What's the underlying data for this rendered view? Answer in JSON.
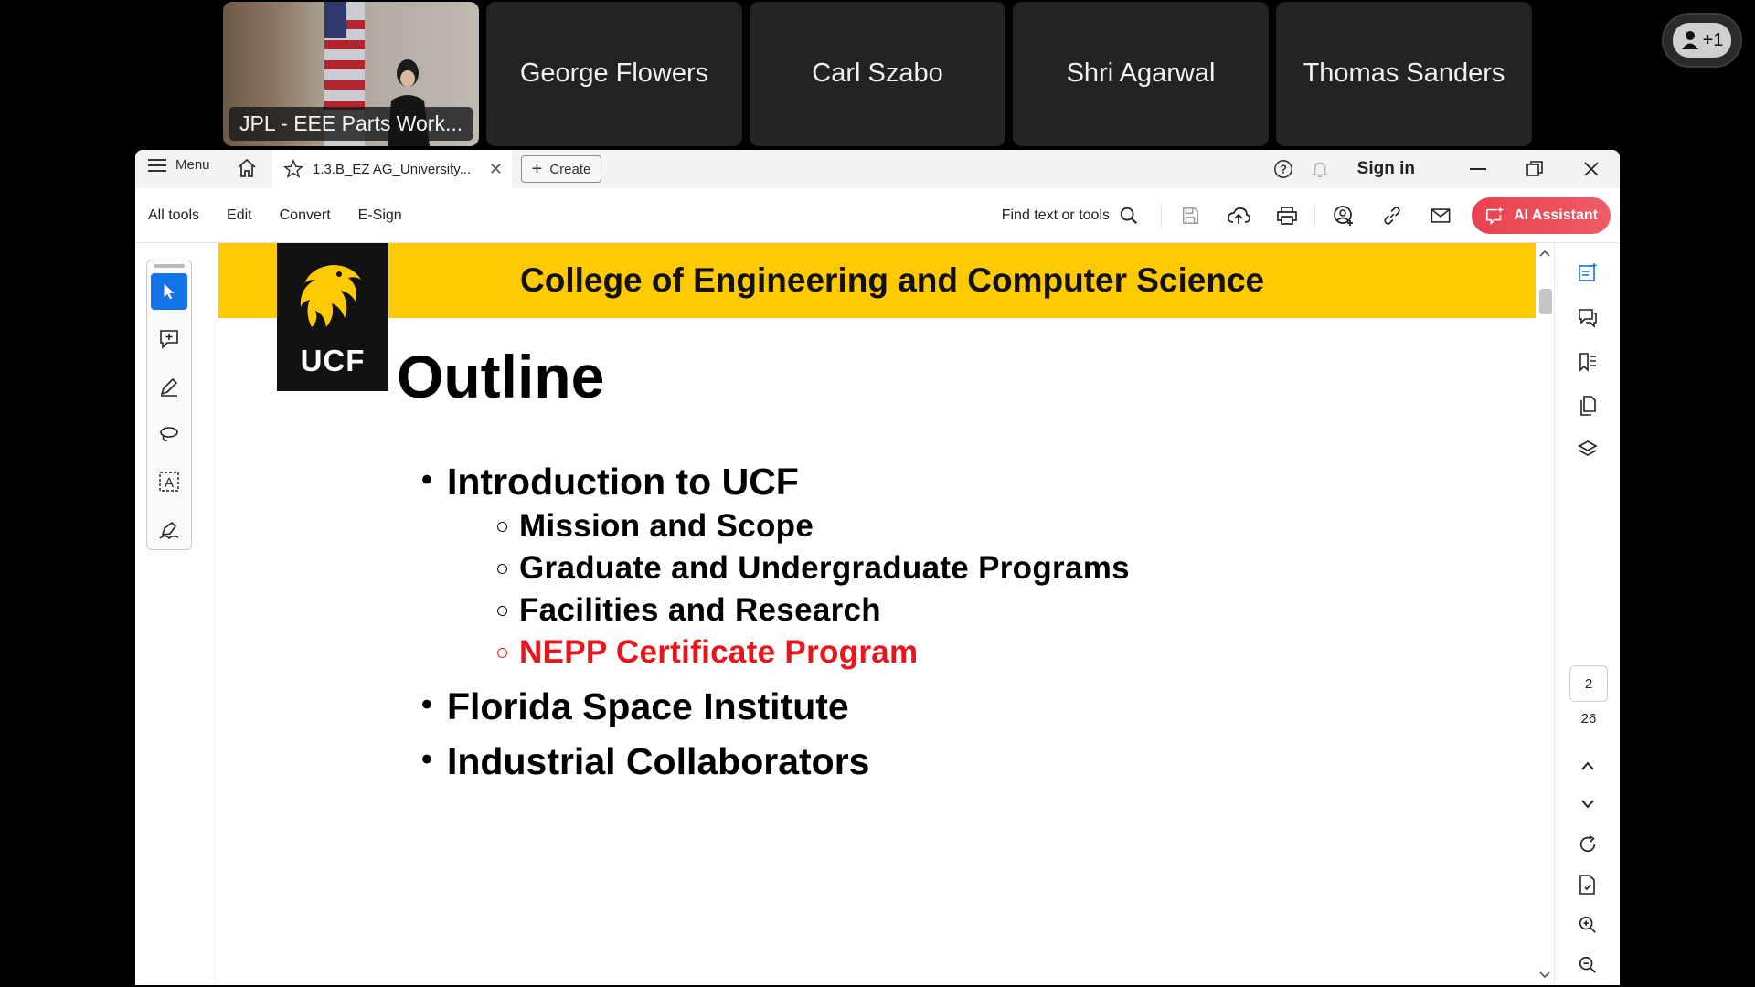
{
  "participants": {
    "video_label": "JPL - EEE Parts Work...",
    "names": [
      "George Flowers",
      "Carl Szabo",
      "Shri Agarwal",
      "Thomas Sanders"
    ],
    "more_count": "+1"
  },
  "titlebar": {
    "menu_label": "Menu",
    "tab_title": "1.3.B_EZ AG_University...",
    "create_label": "Create",
    "sign_in_label": "Sign in"
  },
  "toolbar": {
    "links": [
      "All tools",
      "Edit",
      "Convert",
      "E-Sign"
    ],
    "find_label": "Find text or tools",
    "ai_label": "AI Assistant"
  },
  "slide": {
    "header": "College of Engineering and Computer Science",
    "logo_text": "UCF",
    "title": "Outline",
    "bullets": [
      {
        "text": "Introduction to UCF",
        "sub": [
          "Mission and Scope",
          "Graduate and Undergraduate Programs",
          "Facilities and Research",
          "NEPP Certificate Program"
        ]
      },
      {
        "text": "Florida Space Institute"
      },
      {
        "text": "Industrial Collaborators"
      }
    ],
    "highlight_color": "#e8151b",
    "band_color": "#ffc904"
  },
  "navigation": {
    "current_page": "2",
    "total_pages": "26"
  },
  "colors": {
    "accent": "#1473e6",
    "ai_button": "#e8424f"
  }
}
